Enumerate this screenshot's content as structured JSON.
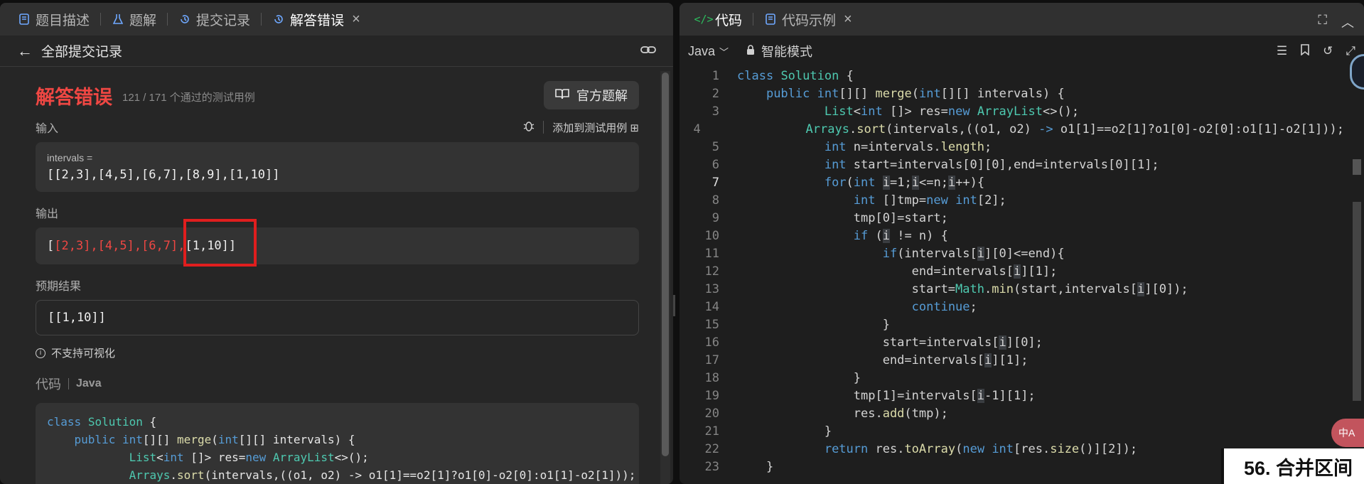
{
  "left": {
    "tabs": [
      {
        "label": "题目描述",
        "icon": "document-icon"
      },
      {
        "label": "题解",
        "icon": "flask-icon"
      },
      {
        "label": "提交记录",
        "icon": "history-icon"
      },
      {
        "label": "解答错误",
        "icon": "history-icon",
        "active": true
      }
    ],
    "back_label": "全部提交记录",
    "result": {
      "title": "解答错误",
      "subtitle": "121 / 171 个通过的测试用例",
      "official_button": "官方题解"
    },
    "input": {
      "label": "输入",
      "add_to_testcase": "添加到测试用例",
      "var_name": "intervals =",
      "value": "[[2,3],[4,5],[6,7],[8,9],[1,10]]"
    },
    "output": {
      "label": "输出",
      "value_diff": "[2,3],[4,5],[6,7],",
      "value_open": "[",
      "value_close": "[1,10]]"
    },
    "expected": {
      "label": "预期结果",
      "value": "[[1,10]]"
    },
    "hint": "不支持可视化",
    "code": {
      "label": "代码",
      "lang": "Java"
    }
  },
  "right": {
    "tabs": [
      {
        "label": "代码",
        "icon": "code-icon",
        "active": true
      },
      {
        "label": "代码示例",
        "icon": "document-icon"
      }
    ],
    "language": "Java",
    "mode": "智能模式",
    "translate": "中A",
    "editor_lines": [
      "1",
      "2",
      "3",
      "4",
      "5",
      "6",
      "7",
      "8",
      "9",
      "10",
      "11",
      "12",
      "13",
      "14",
      "15",
      "16",
      "17",
      "18",
      "19",
      "20",
      "21",
      "22",
      "23"
    ]
  },
  "overlay_title": "56. 合并区间",
  "colors": {
    "error": "#ef4743",
    "keyword": "#569cd6",
    "type": "#4ec9b0",
    "function": "#dcdcaa",
    "annotation_box": "#e01e1e"
  }
}
